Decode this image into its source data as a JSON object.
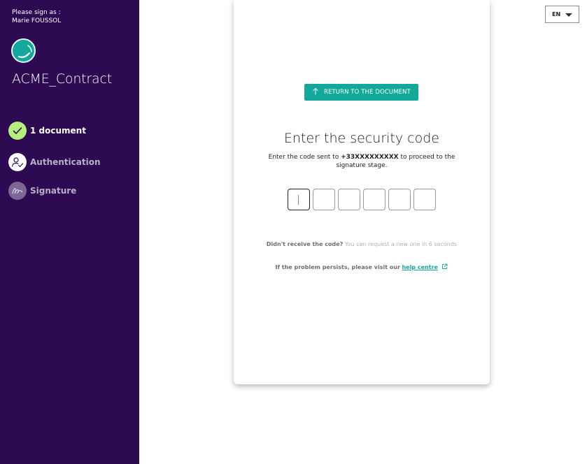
{
  "sidebar": {
    "signer_prompt": "Please sign as :",
    "signer_name": "Marie FOUSSOL",
    "document_title": "ACME_Contract",
    "steps": [
      {
        "label": "1 document",
        "state": "completed",
        "icon": "check-icon"
      },
      {
        "label": "Authentication",
        "state": "current",
        "icon": "user-check-icon"
      },
      {
        "label": "Signature",
        "state": "pending",
        "icon": "signature-icon"
      }
    ]
  },
  "language": {
    "code": "EN"
  },
  "card": {
    "return_button": "RETURN TO THE DOCUMENT",
    "title": "Enter the security code",
    "instruction_pre": "Enter the code sent to ",
    "phone": "+33XXXXXXXXX",
    "instruction_post": " to proceed to the signature stage.",
    "code_length": 6,
    "resend_question": "Didn't receive the code?",
    "resend_wait": "You can request a new one in 6 seconds",
    "help_text": "If the problem persists, please visit our",
    "help_link": "help centre"
  },
  "colors": {
    "sidebar_bg": "#2d0a52",
    "accent": "#12a99a",
    "completed_step": "#b7ef7f"
  }
}
